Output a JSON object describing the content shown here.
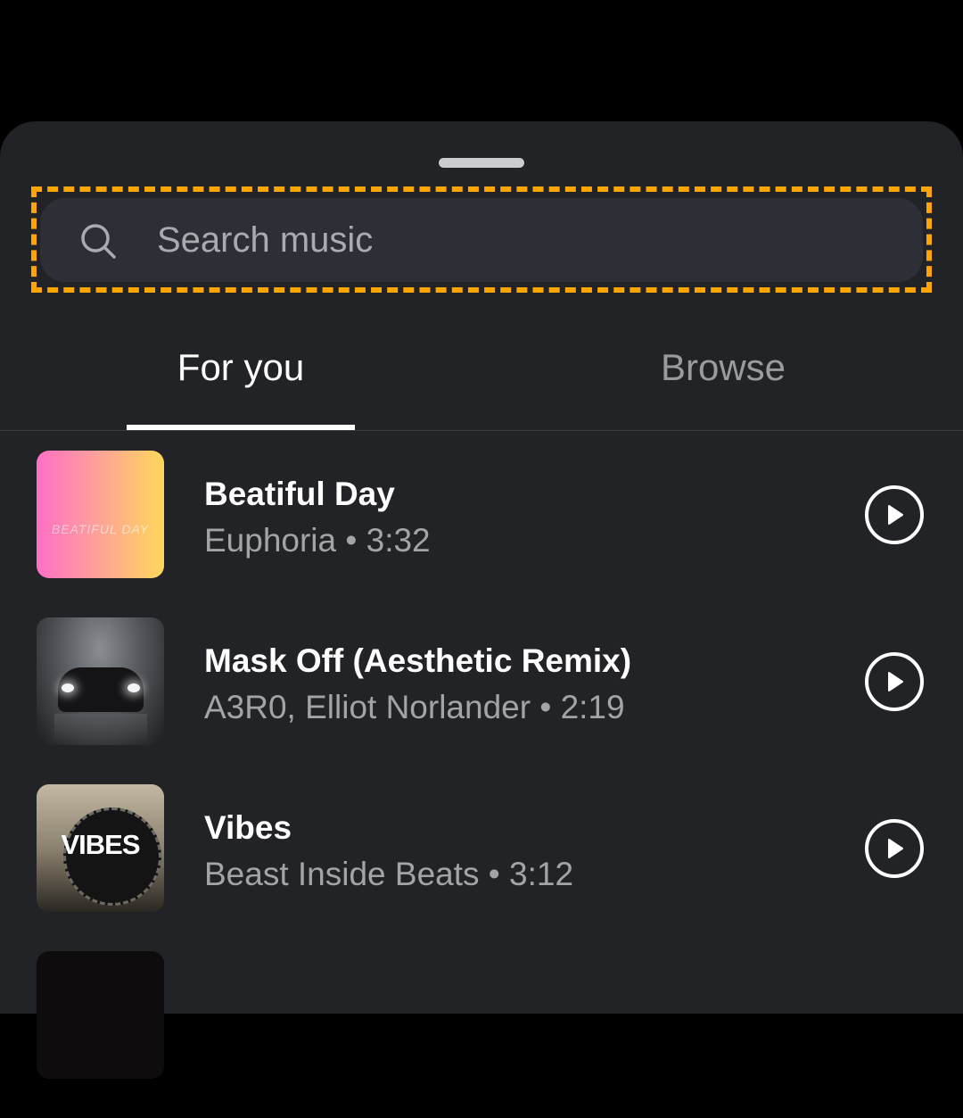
{
  "search": {
    "placeholder": "Search music",
    "value": "",
    "icon": "search-icon",
    "highlight_color": "#ffa500"
  },
  "tabs": [
    {
      "label": "For you",
      "active": true
    },
    {
      "label": "Browse",
      "active": false
    }
  ],
  "tracks": [
    {
      "title": "Beatiful Day",
      "artist": "Euphoria",
      "duration": "3:32",
      "separator": "•",
      "subtitle": "Euphoria • 3:32",
      "cover_text": "BEATIFUL DAY",
      "action_icon": "play-icon"
    },
    {
      "title": "Mask Off (Aesthetic Remix)",
      "artist": "A3R0, Elliot Norlander",
      "duration": "2:19",
      "separator": "•",
      "subtitle": "A3R0, Elliot Norlander • 2:19",
      "action_icon": "play-icon"
    },
    {
      "title": "Vibes",
      "artist": "Beast Inside Beats",
      "duration": "3:12",
      "separator": "•",
      "subtitle": "Beast Inside Beats • 3:12",
      "cover_text": "VIBES",
      "action_icon": "play-icon"
    }
  ],
  "colors": {
    "sheet_background": "#222326",
    "search_background": "#2c2f35",
    "active_tab": "#ffffff",
    "inactive_tab": "#9a9b9e",
    "subtitle_text": "#a3a4a8"
  }
}
